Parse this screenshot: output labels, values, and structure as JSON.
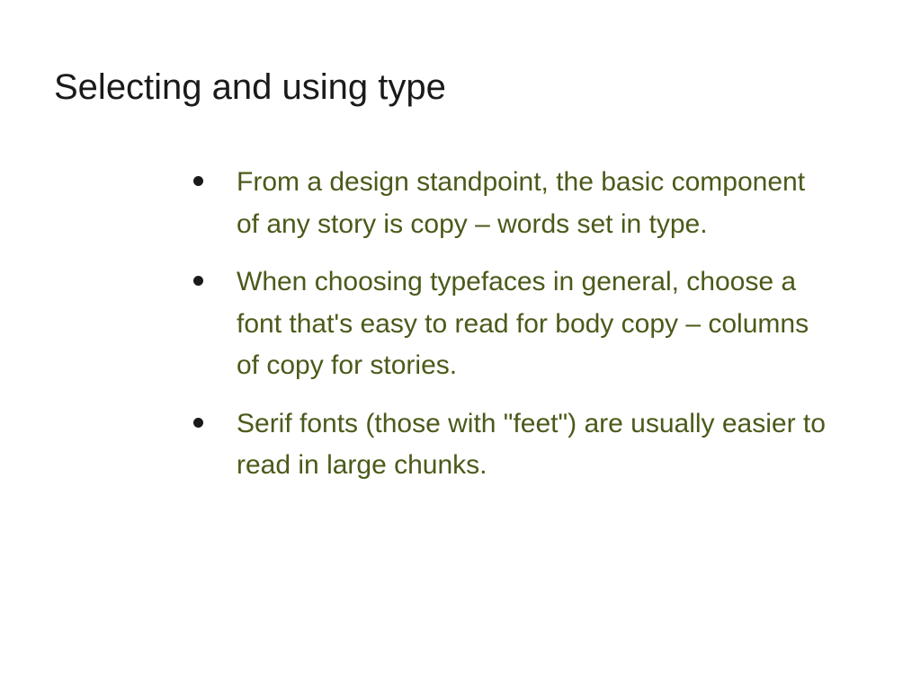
{
  "slide": {
    "title": "Selecting and using type",
    "bullets": [
      "From a design standpoint, the basic component of any story is copy – words set in type.",
      "When choosing typefaces in general, choose a font that's easy to read for body copy – columns of copy for stories.",
      "Serif fonts (those with \"feet\") are usually easier to read in large chunks."
    ]
  }
}
